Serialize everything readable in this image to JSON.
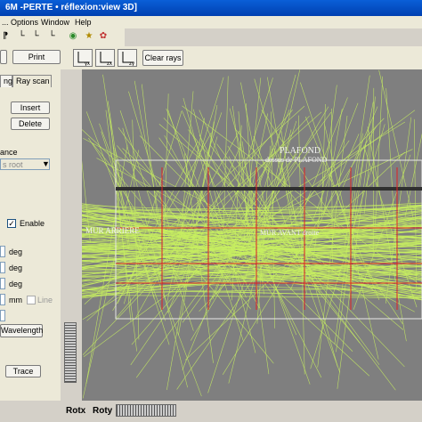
{
  "window": {
    "title": "6M -PERTE • réflexion:view 3D]"
  },
  "menu": {
    "items": [
      "Options",
      "Window",
      "Help"
    ]
  },
  "toolbar": {
    "print_label": "Print",
    "clear_rays_label": "Clear rays"
  },
  "axis_buttons": [
    "yx",
    "zx",
    "zy"
  ],
  "tabs": {
    "partial": "ng",
    "ray_scan": "Ray scan"
  },
  "buttons": {
    "insert": "Insert",
    "delete": "Delete",
    "wavelength": "Wavelength",
    "trace": "Trace"
  },
  "panel": {
    "section_label": "ance",
    "dropdown_value": "s root",
    "enable_label": "Enable",
    "enable_checked": true,
    "units": [
      "deg",
      "deg",
      "deg",
      "mm"
    ],
    "line_label": "Line"
  },
  "viewport": {
    "labels": {
      "plafond": "PLAFOND",
      "plafond_sub": "dessus de PLAFOND",
      "mur_arriere": "MUR ARRIERE",
      "mur_sub": "MUR AVANT droite"
    },
    "colors": {
      "background": "#7f7f7f",
      "rays": "#c8f060",
      "grid": "#e02020",
      "frame": "#e8e8e8"
    }
  },
  "status": {
    "rotx": "Rotx",
    "roty": "Roty"
  }
}
